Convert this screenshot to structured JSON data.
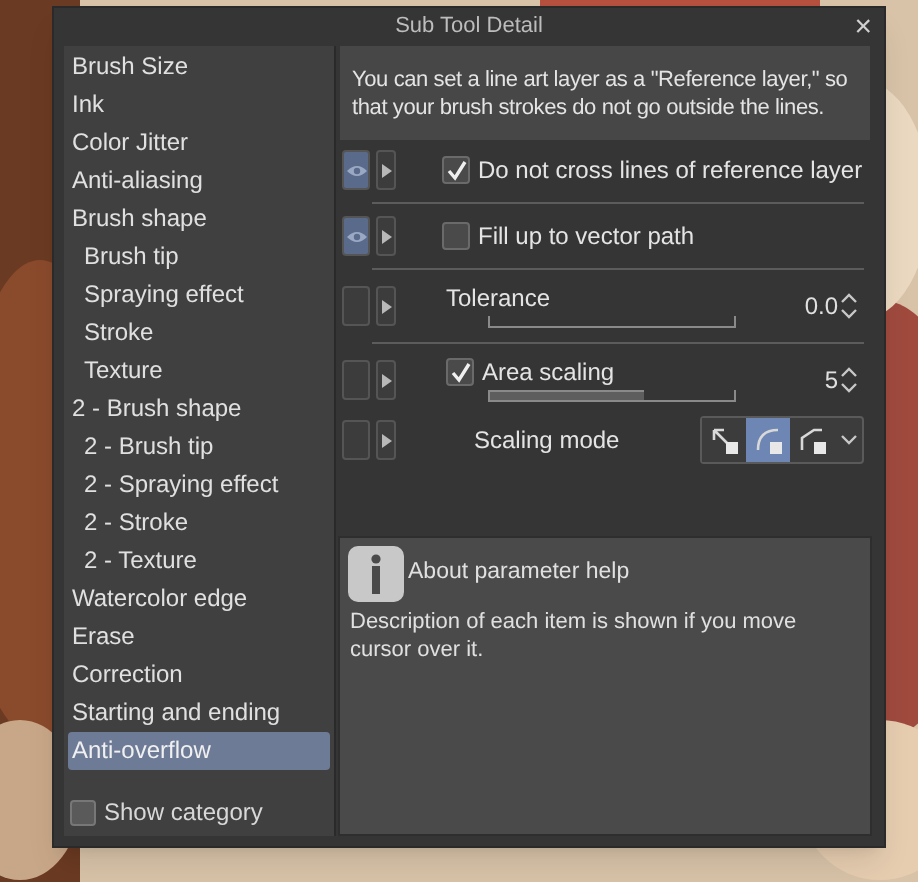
{
  "window": {
    "title": "Sub Tool Detail",
    "close": "×"
  },
  "sidebar": {
    "items": [
      {
        "label": "Brush Size",
        "selected": false
      },
      {
        "label": "Ink",
        "selected": false
      },
      {
        "label": "Color Jitter",
        "selected": false
      },
      {
        "label": "Anti-aliasing",
        "selected": false
      },
      {
        "label": "Brush shape",
        "selected": false,
        "children": [
          {
            "label": "Brush tip",
            "selected": false
          },
          {
            "label": "Spraying effect",
            "selected": false
          },
          {
            "label": "Stroke",
            "selected": false
          },
          {
            "label": "Texture",
            "selected": false
          }
        ]
      },
      {
        "label": "2 - Brush shape",
        "selected": false,
        "children": [
          {
            "label": "2 - Brush tip",
            "selected": false
          },
          {
            "label": "2 - Spraying effect",
            "selected": false
          },
          {
            "label": "2 - Stroke",
            "selected": false
          },
          {
            "label": "2 - Texture",
            "selected": false
          }
        ]
      },
      {
        "label": "Watercolor edge",
        "selected": false
      },
      {
        "label": "Erase",
        "selected": false
      },
      {
        "label": "Correction",
        "selected": false
      },
      {
        "label": "Starting and ending",
        "selected": false
      },
      {
        "label": "Anti-overflow",
        "selected": true
      }
    ],
    "show_category": {
      "label": "Show category",
      "checked": false
    }
  },
  "description": "You can set a line art layer as a \"Reference layer,\" so that your brush strokes do not go outside the lines.",
  "settings": [
    {
      "kind": "checkbox",
      "label": "Do not cross lines of reference layer",
      "checked": true,
      "visible": true
    },
    {
      "kind": "checkbox",
      "label": "Fill up to vector path",
      "checked": false,
      "visible": true
    },
    {
      "kind": "slider",
      "label": "Tolerance",
      "value": "0.0",
      "level": 0,
      "visible": false
    },
    {
      "kind": "slider",
      "label": "Area scaling",
      "checked": true,
      "value": "5",
      "level": 0.63,
      "visible": false
    },
    {
      "kind": "mode",
      "label": "Scaling mode",
      "visible": false,
      "modes": [
        {
          "selected": false
        },
        {
          "selected": true
        },
        {
          "selected": false
        }
      ]
    }
  ],
  "help": {
    "title": "About parameter help",
    "text": "Description of each item is shown if you move cursor over it."
  }
}
